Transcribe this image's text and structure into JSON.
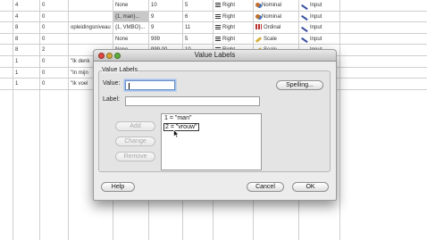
{
  "spreadsheet": {
    "rows": [
      {
        "c1": "4",
        "c2": "0",
        "c3": "",
        "c4": "None",
        "c5": "10",
        "c6": "5",
        "align": "Right",
        "measure": "Nominal",
        "measure_icon": "nominal-icon",
        "role": "Input"
      },
      {
        "c1": "4",
        "c2": "0",
        "c3": "",
        "c4": "{1, man}...",
        "c5": "9",
        "c6": "6",
        "align": "Right",
        "measure": "Nominal",
        "measure_icon": "nominal-icon",
        "role": "Input"
      },
      {
        "c1": "8",
        "c2": "0",
        "c3": "opleidingsniveau",
        "c4": "{1, VMBO}...",
        "c5": "9",
        "c6": "11",
        "align": "Right",
        "measure": "Ordinal",
        "measure_icon": "ordinal-icon",
        "role": "Input"
      },
      {
        "c1": "8",
        "c2": "0",
        "c3": "",
        "c4": "None",
        "c5": "999",
        "c6": "5",
        "align": "Right",
        "measure": "Scale",
        "measure_icon": "scale-icon",
        "role": "Input"
      },
      {
        "c1": "8",
        "c2": "2",
        "c3": "",
        "c4": "None",
        "c5": "999.00",
        "c6": "10",
        "align": "Right",
        "measure": "Scale",
        "measure_icon": "scale-icon",
        "role": "Input"
      },
      {
        "c1": "1",
        "c2": "0",
        "c3": "\"Ik denk",
        "c4": "",
        "c5": "",
        "c6": "",
        "align": "",
        "measure": "",
        "measure_icon": "",
        "role": ""
      },
      {
        "c1": "1",
        "c2": "0",
        "c3": "\"In mijn",
        "c4": "",
        "c5": "",
        "c6": "",
        "align": "",
        "measure": "",
        "measure_icon": "",
        "role": ""
      },
      {
        "c1": "1",
        "c2": "0",
        "c3": "\"Ik voel",
        "c4": "",
        "c5": "",
        "c6": "",
        "align": "",
        "measure": "",
        "measure_icon": "",
        "role": ""
      }
    ]
  },
  "dialog": {
    "title": "Value Labels",
    "group_label": "Value Labels",
    "value_label": "Value:",
    "value_input": "",
    "label_label": "Label:",
    "label_input": "",
    "spelling_button": "Spelling...",
    "add_button": "Add",
    "change_button": "Change",
    "remove_button": "Remove",
    "list_items": [
      "1 = \"man\"",
      "2 = \"vrouw\""
    ],
    "selected_index": 1,
    "help_button": "Help",
    "cancel_button": "Cancel",
    "ok_button": "OK"
  },
  "colors": {
    "close": "#e0463f",
    "minimize": "#d4a93a",
    "zoom": "#5fae3e",
    "focus_ring": "#9fc0ec"
  }
}
